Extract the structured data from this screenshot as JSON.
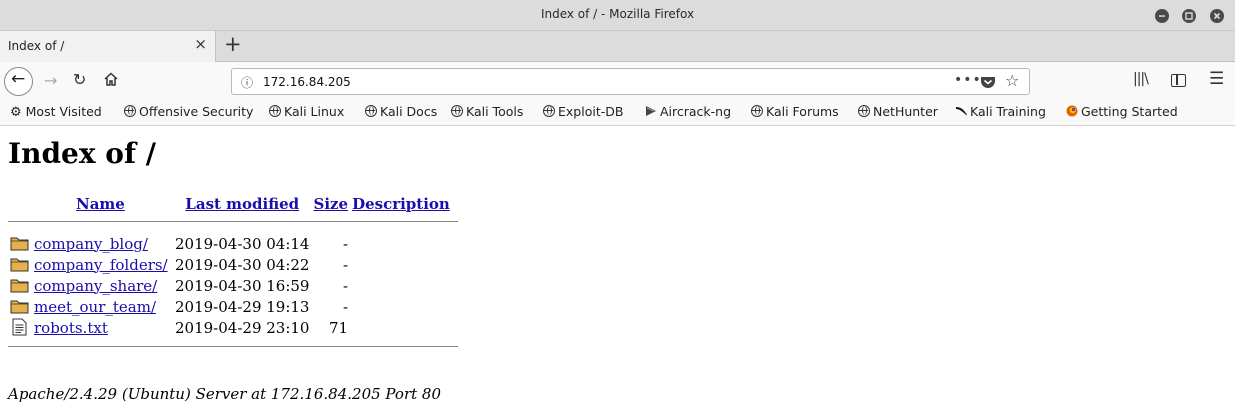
{
  "window": {
    "title": "Index of / - Mozilla Firefox"
  },
  "tab": {
    "label": "Index of /"
  },
  "nav": {
    "url": "172.16.84.205"
  },
  "bookmarks": [
    {
      "label": "Most Visited",
      "icon": "gear-icon"
    },
    {
      "label": "Offensive Security",
      "icon": "globe-icon"
    },
    {
      "label": "Kali Linux",
      "icon": "globe-icon"
    },
    {
      "label": "Kali Docs",
      "icon": "globe-icon"
    },
    {
      "label": "Kali Tools",
      "icon": "globe-icon"
    },
    {
      "label": "Exploit-DB",
      "icon": "globe-icon"
    },
    {
      "label": "Aircrack-ng",
      "icon": "aircrack-icon"
    },
    {
      "label": "Kali Forums",
      "icon": "globe-icon"
    },
    {
      "label": "NetHunter",
      "icon": "globe-icon"
    },
    {
      "label": "Kali Training",
      "icon": "kali-dragon-icon"
    },
    {
      "label": "Getting Started",
      "icon": "firefox-icon"
    }
  ],
  "page": {
    "heading": "Index of /",
    "columns": {
      "name": "Name",
      "modified": "Last modified",
      "size": "Size",
      "description": "Description"
    },
    "rows": [
      {
        "name": "company_blog/",
        "modified": "2019-04-30 04:14",
        "size": "-",
        "icon": "folder-icon"
      },
      {
        "name": "company_folders/",
        "modified": "2019-04-30 04:22",
        "size": "-",
        "icon": "folder-icon"
      },
      {
        "name": "company_share/",
        "modified": "2019-04-30 16:59",
        "size": "-",
        "icon": "folder-icon"
      },
      {
        "name": "meet_our_team/",
        "modified": "2019-04-29 19:13",
        "size": "-",
        "icon": "folder-icon"
      },
      {
        "name": "robots.txt",
        "modified": "2019-04-29 23:10",
        "size": "71",
        "icon": "text-file-icon"
      }
    ],
    "address": "Apache/2.4.29 (Ubuntu) Server at 172.16.84.205 Port 80"
  },
  "colors": {
    "link": "#1a0dab",
    "chrome": "#dcdcdc",
    "folder": "#e8b04a"
  }
}
